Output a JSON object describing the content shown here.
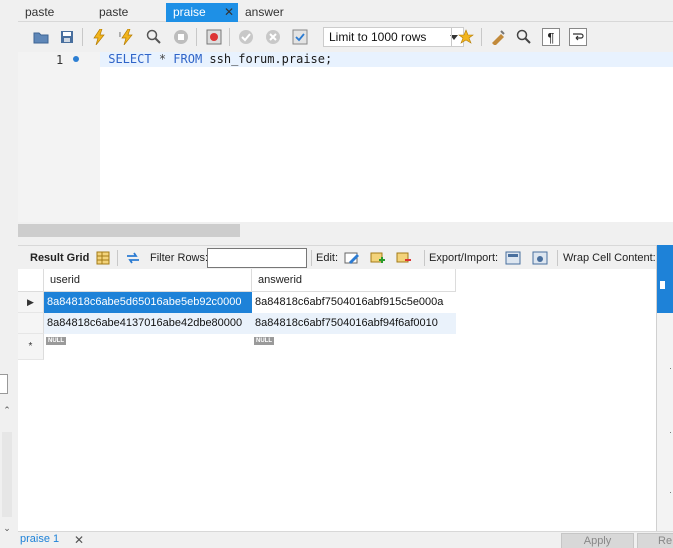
{
  "tabs": [
    {
      "label": "paste"
    },
    {
      "label": "paste"
    },
    {
      "label": "praise",
      "active": true
    },
    {
      "label": "answer"
    }
  ],
  "toolbar": {
    "limit_label": "Limit to 1000 rows",
    "icons": [
      "open-folder-icon",
      "save-icon",
      "execute-icon",
      "execute-current-icon",
      "explain-icon",
      "stop-icon",
      "toggle-error-icon",
      "commit-icon",
      "rollback-icon",
      "autocommit-icon",
      "bookmark-icon",
      "beautify-icon",
      "find-icon",
      "invisible-chars-icon",
      "wrap-icon"
    ]
  },
  "editor": {
    "line_number": "1",
    "sql": {
      "kw1": "SELECT",
      "star": " * ",
      "kw2": "FROM",
      "table": " ssh_forum.praise;"
    }
  },
  "result_toolbar": {
    "result_grid": "Result Grid",
    "filter_rows": "Filter Rows:",
    "edit": "Edit:",
    "export_import": "Export/Import:",
    "wrap_cell": "Wrap Cell Content:"
  },
  "grid": {
    "columns": [
      "userid",
      "answerid"
    ],
    "rows": [
      [
        "8a84818c6abe5d65016abe5eb92c0000",
        "8a84818c6abf7504016abf915c5e000a"
      ],
      [
        "8a84818c6abe4137016abe42dbe80000",
        "8a84818c6abf7504016abf94f6af0010"
      ]
    ],
    "null_label": "NULL",
    "new_row_marker": "*"
  },
  "bottom": {
    "result_tab": "praise 1",
    "apply": "Apply",
    "revert": "Re"
  },
  "colors": {
    "accent": "#1e82d8",
    "selected_row": "#1e82d8",
    "keyword": "#2f64c8"
  }
}
